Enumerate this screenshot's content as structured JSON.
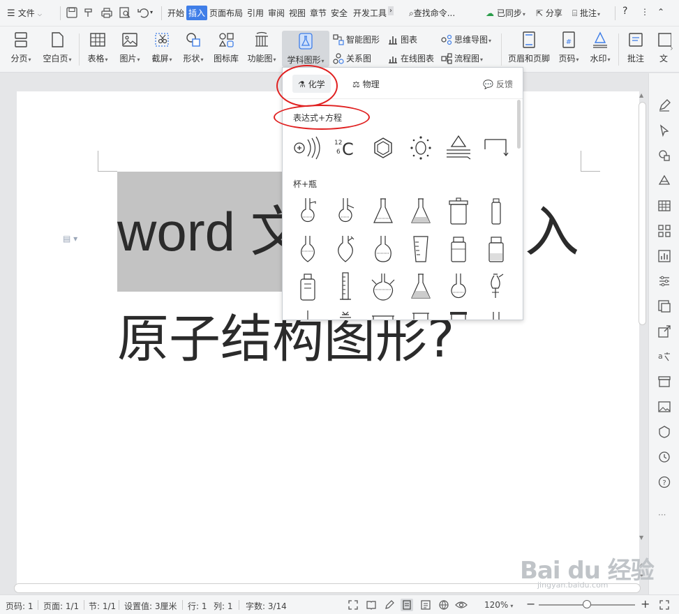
{
  "menubar": {
    "file": "文件",
    "tabs": [
      "开始",
      "插入",
      "页面布局",
      "引用",
      "审阅",
      "视图",
      "章节",
      "安全",
      "开发工具"
    ],
    "active_tab": "插入",
    "search": "查找命令...",
    "sync": "已同步",
    "share": "分享",
    "annotate": "批注",
    "help": "?"
  },
  "ribbon": {
    "pagination": "分页",
    "blank_page": "空白页",
    "table": "表格",
    "picture": "图片",
    "screenshot": "截屏",
    "shape": "形状",
    "icon_lib": "图标库",
    "function_chart": "功能图",
    "subject_graphics": "学科图形",
    "smart_graphic": "智能图形",
    "chart": "图表",
    "mindmap": "思维导图",
    "relation_chart": "关系图",
    "online_chart": "在线图表",
    "flowchart": "流程图",
    "header_footer": "页眉和页脚",
    "page_number": "页码",
    "watermark": "水印",
    "comment": "批注",
    "textbox": "文"
  },
  "document": {
    "line1": "word 文",
    "line1_end": "入",
    "line2": "原子结构图形?"
  },
  "panel": {
    "tab_chemistry": "化学",
    "tab_physics": "物理",
    "feedback": "反馈",
    "section1": "表达式+方程",
    "section2": "杯+瓶",
    "carbon_mass": "12",
    "carbon_num": "6",
    "carbon_sym": "C"
  },
  "status": {
    "page_num": "页码: 1",
    "pages": "页面: 1/1",
    "section": "节: 1/1",
    "setting": "设置值: 3厘米",
    "row": "行: 1",
    "col": "列: 1",
    "words": "字数: 3/14",
    "zoom": "120%"
  },
  "watermark_text": "Bai du 经验",
  "watermark_url": "jingyan.baidu.com"
}
